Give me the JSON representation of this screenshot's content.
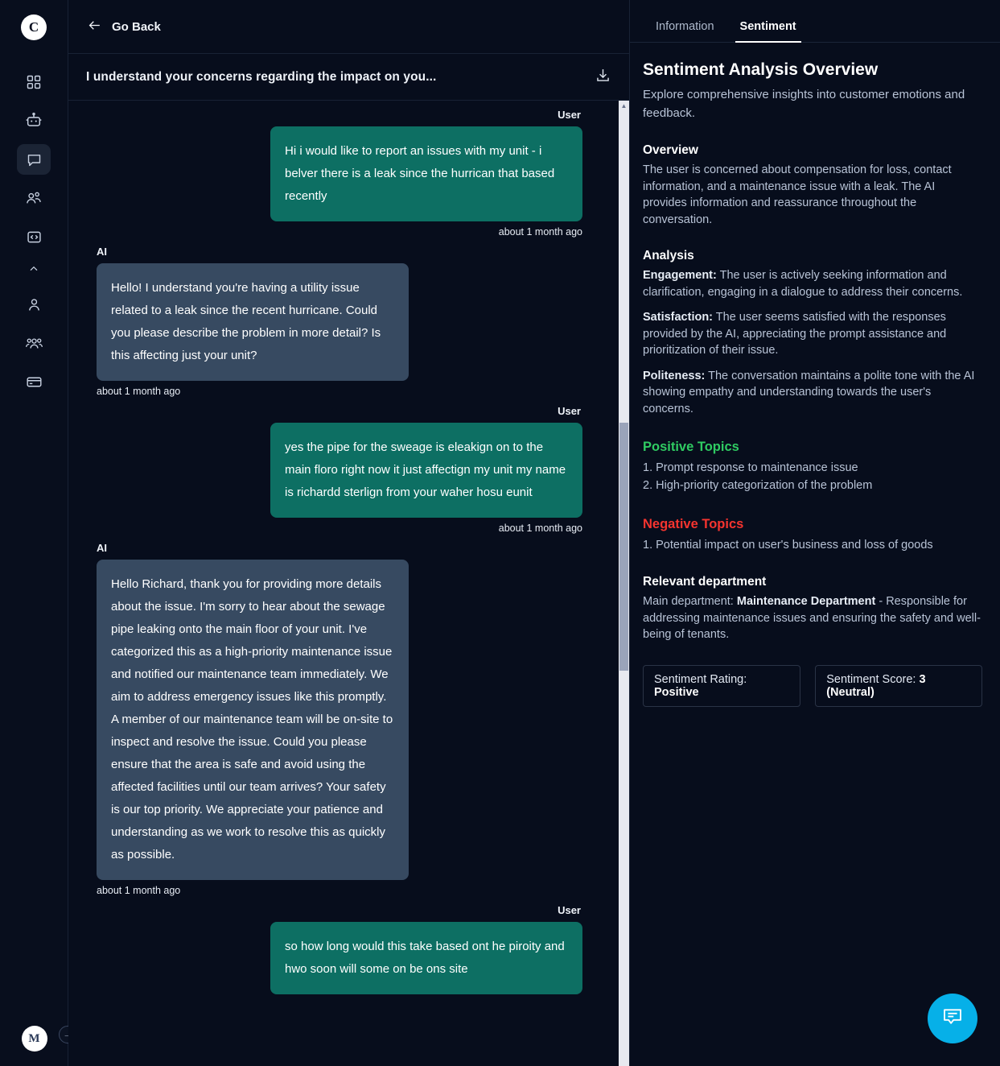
{
  "rail": {
    "logo_label": "C",
    "items": [
      {
        "name": "grid-icon",
        "label": "Dashboard"
      },
      {
        "name": "robot-icon",
        "label": "Bots"
      },
      {
        "name": "chat-bubble-icon",
        "label": "Conversations"
      },
      {
        "name": "two-people-icon",
        "label": "Contacts"
      },
      {
        "name": "code-icon",
        "label": "Developers"
      }
    ],
    "chevron_label": "Collapse",
    "items_lower": [
      {
        "name": "person-icon",
        "label": "Account"
      },
      {
        "name": "group-icon",
        "label": "Team"
      },
      {
        "name": "card-icon",
        "label": "Billing"
      }
    ],
    "avatar_label": "M",
    "expand_label": "→"
  },
  "topbar": {
    "back_label": "Go Back",
    "back_icon": "arrow-left-icon"
  },
  "conversation": {
    "title": "I understand your concerns regarding the impact on you...",
    "download_icon": "download-icon"
  },
  "messages": [
    {
      "role": "User",
      "text": "Hi i would like to report an issues with my unit - i belver there is a leak since the hurrican that based recently",
      "time": "about 1 month ago"
    },
    {
      "role": "AI",
      "text": "Hello! I understand you're having a utility issue related to a leak since the recent hurricane. Could you please describe the problem in more detail? Is this affecting just your unit?",
      "time": "about 1 month ago"
    },
    {
      "role": "User",
      "text": "yes the pipe for the sweage is eleakign on to the main floro right now it just affectign my unit my name is richardd sterlign from your waher hosu eunit",
      "time": "about 1 month ago"
    },
    {
      "role": "AI",
      "text": "Hello Richard, thank you for providing more details about the issue. I'm sorry to hear about the sewage pipe leaking onto the main floor of your unit. I've categorized this as a high-priority maintenance issue and notified our maintenance team immediately. We aim to address emergency issues like this promptly. A member of our maintenance team will be on-site to inspect and resolve the issue. Could you please ensure that the area is safe and avoid using the affected facilities until our team arrives? Your safety is our top priority. We appreciate your patience and understanding as we work to resolve this as quickly as possible.",
      "time": "about 1 month ago"
    },
    {
      "role": "User",
      "text": "so how long would this take based ont he piroity and hwo soon will some on be ons site",
      "time": ""
    }
  ],
  "right_panel": {
    "tabs": [
      {
        "label": "Information",
        "active": false
      },
      {
        "label": "Sentiment",
        "active": true
      }
    ],
    "title": "Sentiment Analysis Overview",
    "subtitle": "Explore comprehensive insights into customer emotions and feedback.",
    "overview_heading": "Overview",
    "overview_text": "The user is concerned about compensation for loss, contact information, and a maintenance issue with a leak. The AI provides information and reassurance throughout the conversation.",
    "analysis_heading": "Analysis",
    "analysis": [
      {
        "label": "Engagement:",
        "text": " The user is actively seeking information and clarification, engaging in a dialogue to address their concerns."
      },
      {
        "label": "Satisfaction:",
        "text": " The user seems satisfied with the responses provided by the AI, appreciating the prompt assistance and prioritization of their issue."
      },
      {
        "label": "Politeness:",
        "text": " The conversation maintains a polite tone with the AI showing empathy and understanding towards the user's concerns."
      }
    ],
    "positive_heading": "Positive Topics",
    "positive_topics": [
      "1. Prompt response to maintenance issue",
      "2. High-priority categorization of the problem"
    ],
    "negative_heading": "Negative Topics",
    "negative_topics": [
      "1. Potential impact on user's business and loss of goods"
    ],
    "department_heading": "Relevant department",
    "department_prefix": "Main department: ",
    "department_name": "Maintenance Department",
    "department_suffix": " - Responsible for addressing maintenance issues and ensuring the safety and well-being of tenants.",
    "rating_label": "Sentiment Rating: ",
    "rating_value": "Positive",
    "score_label": "Sentiment Score: ",
    "score_value": "3 (Neutral)"
  },
  "fab": {
    "icon": "chat-bubble-icon",
    "color": "#06b0e8"
  },
  "colors": {
    "user_bubble": "#0d6f63",
    "ai_bubble": "#374a61",
    "positive": "#2fcb62",
    "negative": "#f6342f",
    "background": "#070d1c"
  }
}
